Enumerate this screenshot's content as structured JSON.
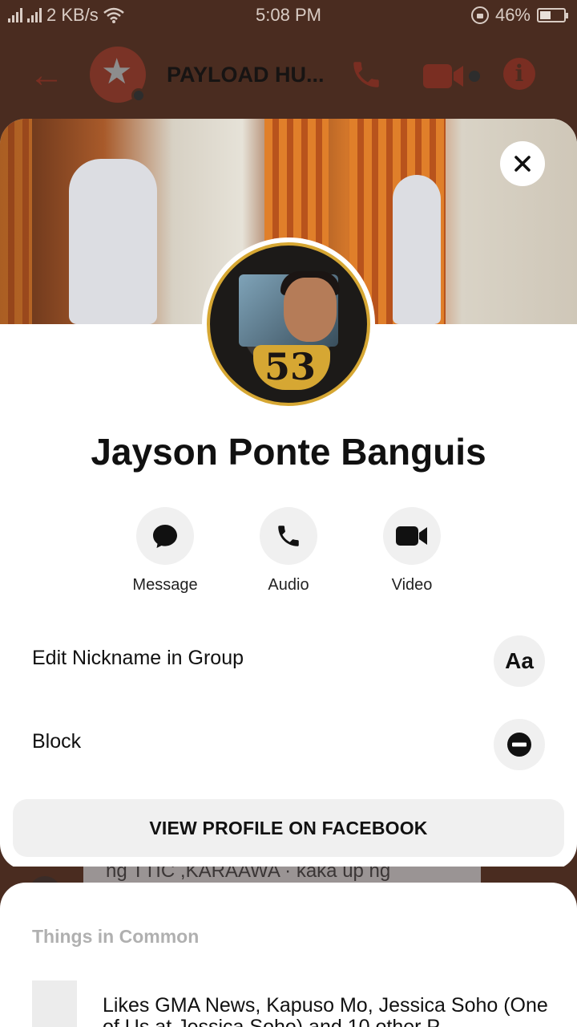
{
  "status_bar": {
    "network_speed": "2 KB/s",
    "time": "5:08 PM",
    "battery": "46%",
    "battery_level": 0.46,
    "icons": [
      "signal-icon",
      "wifi-icon",
      "rotation-lock-icon",
      "battery-icon"
    ]
  },
  "chat_header": {
    "title": "PAYLOAD HU...",
    "icons": [
      "back-arrow-icon",
      "phone-icon",
      "video-camera-icon",
      "info-icon"
    ]
  },
  "profile": {
    "name": "Jayson Ponte Banguis",
    "close_icon": "close-icon",
    "avatar_number": "53"
  },
  "actions": [
    {
      "label": "Message",
      "icon": "message-bubble-icon"
    },
    {
      "label": "Audio",
      "icon": "phone-icon"
    },
    {
      "label": "Video",
      "icon": "video-camera-icon"
    }
  ],
  "options": {
    "edit_nickname": {
      "label": "Edit Nickname in Group",
      "icon_text": "Aa"
    },
    "block": {
      "label": "Block",
      "icon": "block-icon"
    }
  },
  "view_profile_button": "VIEW PROFILE ON FACEBOOK",
  "background_snippet": "ng TTIC ,KARAAWA · kaka up ng",
  "things_in_common": {
    "title": "Things in Common",
    "item_text": "Likes GMA News, Kapuso Mo, Jessica Soho (One",
    "item_text_cont": "of Us at Jessica Soho) and 10 other P"
  },
  "colors": {
    "backdrop": "#4a2c20",
    "card": "#ffffff",
    "button_bg": "#f0f0f0",
    "muted_text": "#b0b0b0"
  }
}
